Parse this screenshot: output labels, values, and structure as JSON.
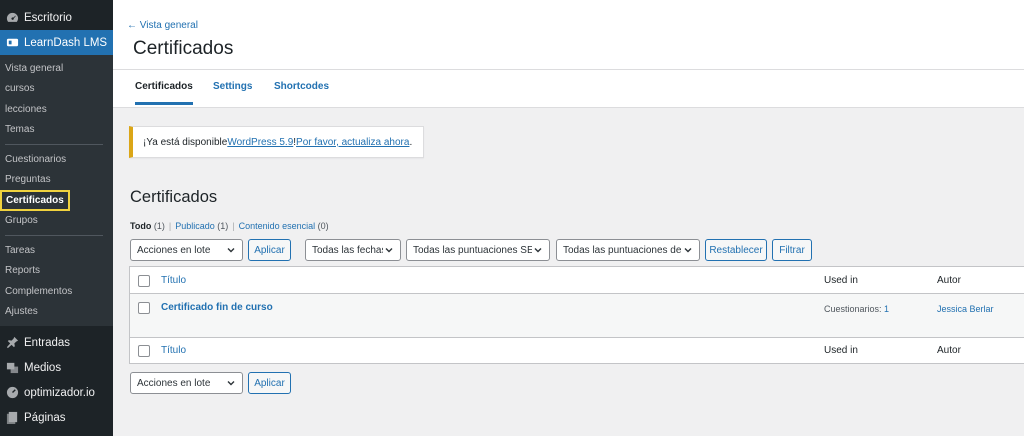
{
  "sidebar": {
    "top_items": [
      {
        "label": "Escritorio",
        "icon": "dashboard-icon"
      },
      {
        "label": "LearnDash LMS",
        "icon": "learndash-icon",
        "active": true
      }
    ],
    "submenu": [
      {
        "label": "Vista general"
      },
      {
        "label": "cursos"
      },
      {
        "label": "lecciones"
      },
      {
        "label": "Temas"
      },
      {
        "label": "Cuestionarios"
      },
      {
        "label": "Preguntas"
      },
      {
        "label": "Certificados",
        "current": true
      },
      {
        "label": "Grupos"
      },
      {
        "label": "Tareas"
      },
      {
        "label": "Reports"
      },
      {
        "label": "Complementos"
      },
      {
        "label": "Ajustes"
      }
    ],
    "lower_items": [
      {
        "label": "Entradas",
        "icon": "pin-icon"
      },
      {
        "label": "Medios",
        "icon": "media-icon"
      },
      {
        "label": "optimizador.io",
        "icon": "gauge-icon"
      },
      {
        "label": "Páginas",
        "icon": "pages-icon"
      }
    ]
  },
  "header": {
    "back_link": "← Vista general",
    "title": "Certificados",
    "tabs": [
      {
        "label": "Certificados",
        "active": true
      },
      {
        "label": "Settings"
      },
      {
        "label": "Shortcodes"
      }
    ]
  },
  "notice": {
    "prefix": "¡Ya está disponible ",
    "link1": "WordPress 5.9",
    "middle": "! ",
    "link2": "Por favor, actualiza ahora",
    "suffix": "."
  },
  "section": {
    "title": "Certificados",
    "views": [
      {
        "label": "Todo",
        "count": "(1)",
        "current": true
      },
      {
        "label": "Publicado",
        "count": "(1)"
      },
      {
        "label": "Contenido esencial",
        "count": "(0)"
      }
    ]
  },
  "filters": {
    "bulk_select": "Acciones en lote",
    "apply": "Aplicar",
    "dates": "Todas las fechas",
    "scores_seo": "Todas las puntuaciones SEO",
    "scores_readability": "Todas las puntuaciones de",
    "reset": "Restablecer",
    "filter": "Filtrar"
  },
  "table": {
    "columns": {
      "title": "Título",
      "used_in": "Used in",
      "author": "Autor"
    },
    "rows": [
      {
        "title": "Certificado fin de curso",
        "used_in_label": "Cuestionarios: ",
        "used_in_count": "1",
        "author": "Jessica Berlar"
      }
    ]
  },
  "bottom": {
    "bulk_select": "Acciones en lote",
    "apply": "Aplicar"
  },
  "colors": {
    "sidebar_bg": "#1d2327",
    "submenu_bg": "#2c3338",
    "accent": "#2271b1",
    "notice_border": "#dba617",
    "highlight": "#f0d23e"
  }
}
